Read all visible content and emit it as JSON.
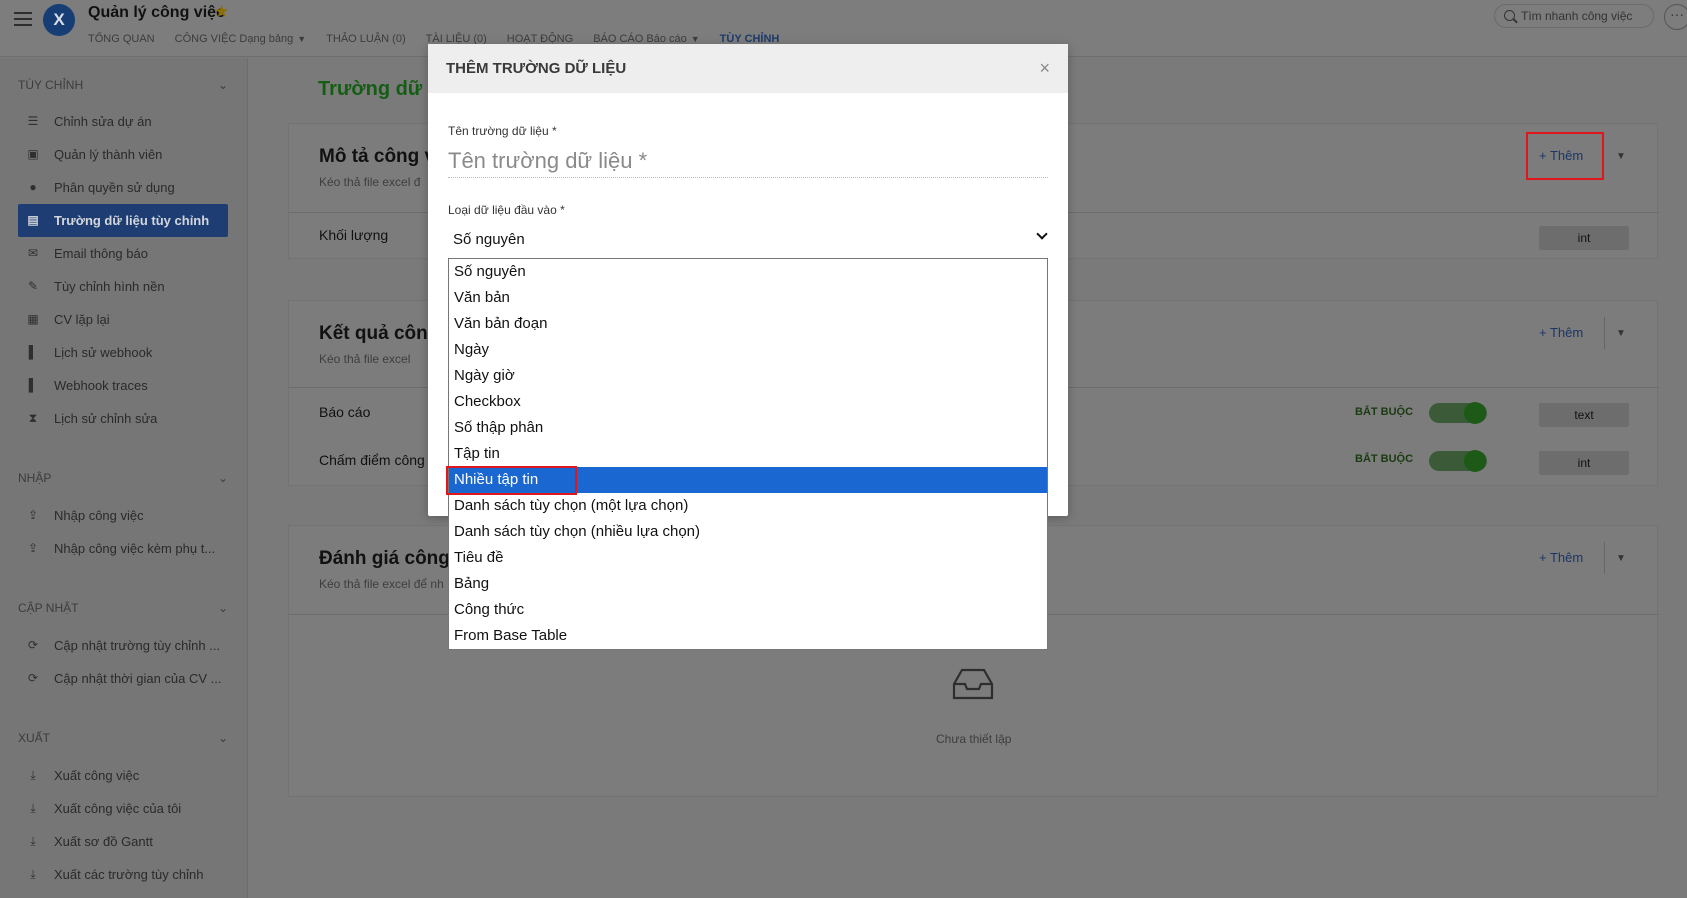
{
  "app": {
    "title": "Quản lý công việc",
    "logo_letter": "X",
    "star": "★"
  },
  "nav": [
    {
      "label": "TỔNG QUAN"
    },
    {
      "label": "CÔNG VIỆC",
      "suffix": "Dạng bảng",
      "caret": "▼"
    },
    {
      "label": "THẢO LUẬN (0)"
    },
    {
      "label": "TÀI LIỆU (0)"
    },
    {
      "label": "HOẠT ĐỘNG"
    },
    {
      "label": "BÁO CÁO",
      "suffix": "Báo cáo",
      "caret": "▼"
    },
    {
      "label": "TÙY CHỈNH"
    }
  ],
  "search": {
    "placeholder": "Tìm nhanh công việc"
  },
  "more_label": "···",
  "sidebar": {
    "groups": [
      {
        "title": "TÙY CHỈNH",
        "chevron": "⌄"
      },
      {
        "title": "NHẬP",
        "chevron": "⌄"
      },
      {
        "title": "CẬP NHẬT",
        "chevron": "⌄"
      },
      {
        "title": "XUẤT",
        "chevron": "⌄"
      }
    ],
    "items": [
      {
        "label": "Chỉnh sửa dự án",
        "icon": "☰"
      },
      {
        "label": "Quản lý thành viên",
        "icon": "▣"
      },
      {
        "label": "Phân quyền sử dụng",
        "icon": "●"
      },
      {
        "label": "Trường dữ liệu tùy chỉnh",
        "icon": "▤"
      },
      {
        "label": "Email thông báo",
        "icon": "✉"
      },
      {
        "label": "Tùy chỉnh hình nền",
        "icon": "✎"
      },
      {
        "label": "CV lặp lại",
        "icon": "▦"
      },
      {
        "label": "Lịch sử webhook",
        "icon": "▌"
      },
      {
        "label": "Webhook traces",
        "icon": "▌"
      },
      {
        "label": "Lịch sử chỉnh sửa",
        "icon": "⧗"
      },
      {
        "label": "Nhập công việc",
        "icon": "⇪"
      },
      {
        "label": "Nhập công việc kèm phụ t...",
        "icon": "⇪"
      },
      {
        "label": "Cập nhật trường tùy chỉnh ...",
        "icon": "⟳"
      },
      {
        "label": "Cập nhật thời gian của CV ...",
        "icon": "⟳"
      },
      {
        "label": "Xuất công việc",
        "icon": "⤓"
      },
      {
        "label": "Xuất công việc của tôi",
        "icon": "⤓"
      },
      {
        "label": "Xuất sơ đồ Gantt",
        "icon": "⤓"
      },
      {
        "label": "Xuất các trường tùy chỉnh",
        "icon": "⤓"
      }
    ]
  },
  "main": {
    "title": "Trường dữ li",
    "add_label": "+ Thêm",
    "add_dropdown": "▼",
    "cards": [
      {
        "title": "Mô tả công v",
        "subtitle": "Kéo thả file excel đ",
        "rows": [
          {
            "label": "Khối lượng",
            "type": "int",
            "required": ""
          }
        ]
      },
      {
        "title": "Kết quả công",
        "subtitle": "Kéo thả file excel",
        "rows": [
          {
            "label": "Báo cáo",
            "type": "text",
            "required": "BẮT BUỘC"
          },
          {
            "label": "Chấm điểm công",
            "type": "int",
            "required": "BẮT BUỘC"
          }
        ]
      },
      {
        "title": "Đánh giá công",
        "subtitle": "Kéo thả file excel để nh",
        "empty_text": "Chưa thiết lập"
      }
    ]
  },
  "modal": {
    "title": "THÊM TRƯỜNG DỮ LIỆU",
    "close": "×",
    "name_label": "Tên trường dữ liệu *",
    "name_placeholder": "Tên trường dữ liệu *",
    "name_value": "",
    "type_label": "Loại dữ liệu đầu vào *",
    "type_selected": "Số nguyên"
  },
  "dropdown": {
    "options": [
      "Số nguyên",
      "Văn bản",
      "Văn bản đoạn",
      "Ngày",
      "Ngày giờ",
      "Checkbox",
      "Số thập phân",
      "Tập tin",
      "Nhiều tập tin",
      "Danh sách tùy chọn (một lựa chọn)",
      "Danh sách tùy chọn (nhiều lựa chọn)",
      "Tiêu đề",
      "Bảng",
      "Công thức",
      "From Base Table"
    ],
    "highlighted": "Nhiều tập tin"
  },
  "colors": {
    "sidebar_active": "#1e3e73",
    "option_highlight": "#1a67d2",
    "annotation_red": "#e0161c",
    "title_green": "#145e14"
  }
}
